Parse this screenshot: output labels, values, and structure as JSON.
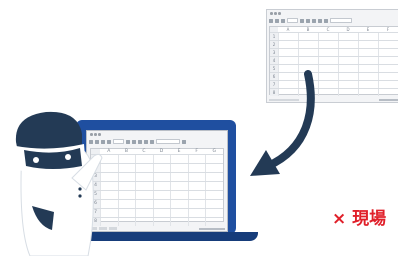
{
  "spreadsheet": {
    "columns": [
      "A",
      "B",
      "C",
      "D",
      "E",
      "F",
      "G"
    ],
    "rows": [
      "1",
      "2",
      "3",
      "4",
      "5",
      "6",
      "7",
      "8"
    ]
  },
  "small_sheet": {
    "columns": [
      "A",
      "B",
      "C",
      "D",
      "E",
      "F"
    ],
    "rows": [
      "1",
      "2",
      "3",
      "4",
      "5",
      "6",
      "7",
      "8"
    ]
  },
  "caption": "× 現場",
  "colors": {
    "laptop_frame": "#1f4fa0",
    "laptop_base": "#163c7a",
    "robot_body": "#ffffff",
    "robot_dark": "#233a55",
    "arrow": "#233a55",
    "caption": "#e0202a"
  }
}
